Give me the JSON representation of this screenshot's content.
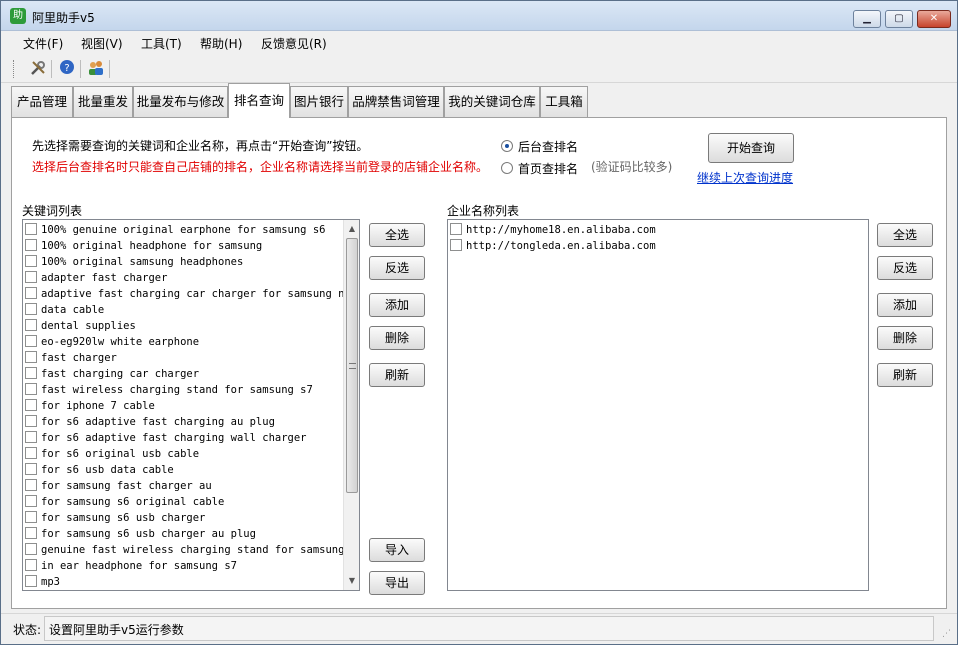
{
  "window": {
    "title": "阿里助手v5",
    "icon_glyph": "助",
    "accent": "#2e9b3a"
  },
  "menu": [
    "文件(F)",
    "视图(V)",
    "工具(T)",
    "帮助(H)",
    "反馈意见(R)"
  ],
  "toolbar": {
    "icons": [
      "tools-icon",
      "help-icon",
      "users-icon"
    ]
  },
  "tabs": [
    "产品管理",
    "批量重发",
    "批量发布与修改",
    "排名查询",
    "图片银行",
    "品牌禁售词管理",
    "我的关键词仓库",
    "工具箱"
  ],
  "active_tab": "排名查询",
  "hint_instruction": "先选择需要查询的关键词和企业名称，再点击“开始查询”按钮。",
  "hint_warning": "选择后台查排名时只能查自己店铺的排名，企业名称请选择当前登录的店铺企业名称。",
  "query_mode": {
    "options": [
      "后台查排名",
      "首页查排名"
    ],
    "selected": "后台查排名",
    "captcha_note": "(验证码比较多)"
  },
  "start_button": "开始查询",
  "resume_link": "继续上次查询进度",
  "keyword_list": {
    "label": "关键词列表",
    "items": [
      "100% genuine original earphone for samsung s6",
      "100% original headphone  for samsung",
      "100% original samsung headphones",
      "adapter fast charger",
      "adaptive fast charging car charger for samsung not",
      "data cable",
      "dental supplies",
      "eo-eg920lw white earphone",
      "fast charger",
      "fast charging car charger",
      "fast wireless charging stand for samsung s7",
      "for iphone 7 cable",
      "for s6 adaptive fast charging au plug",
      "for s6 adaptive fast charging wall charger",
      "for s6 original usb cable",
      "for s6 usb data cable",
      "for samsung fast charger au",
      "for samsung s6 original cable",
      "for samsung s6 usb charger",
      "for samsung s6 usb charger au plug",
      "genuine fast wireless charging stand for samsung",
      "in ear headphone for samsung s7",
      "mp3"
    ]
  },
  "company_list": {
    "label": "企业名称列表",
    "items": [
      "http://myhome18.en.alibaba.com",
      "http://tongleda.en.alibaba.com"
    ]
  },
  "list_buttons": {
    "select_all": "全选",
    "invert": "反选",
    "add": "添加",
    "delete": "删除",
    "refresh": "刷新",
    "import": "导入",
    "export": "导出"
  },
  "status": {
    "label": "状态:",
    "text": "设置阿里助手v5运行参数"
  }
}
